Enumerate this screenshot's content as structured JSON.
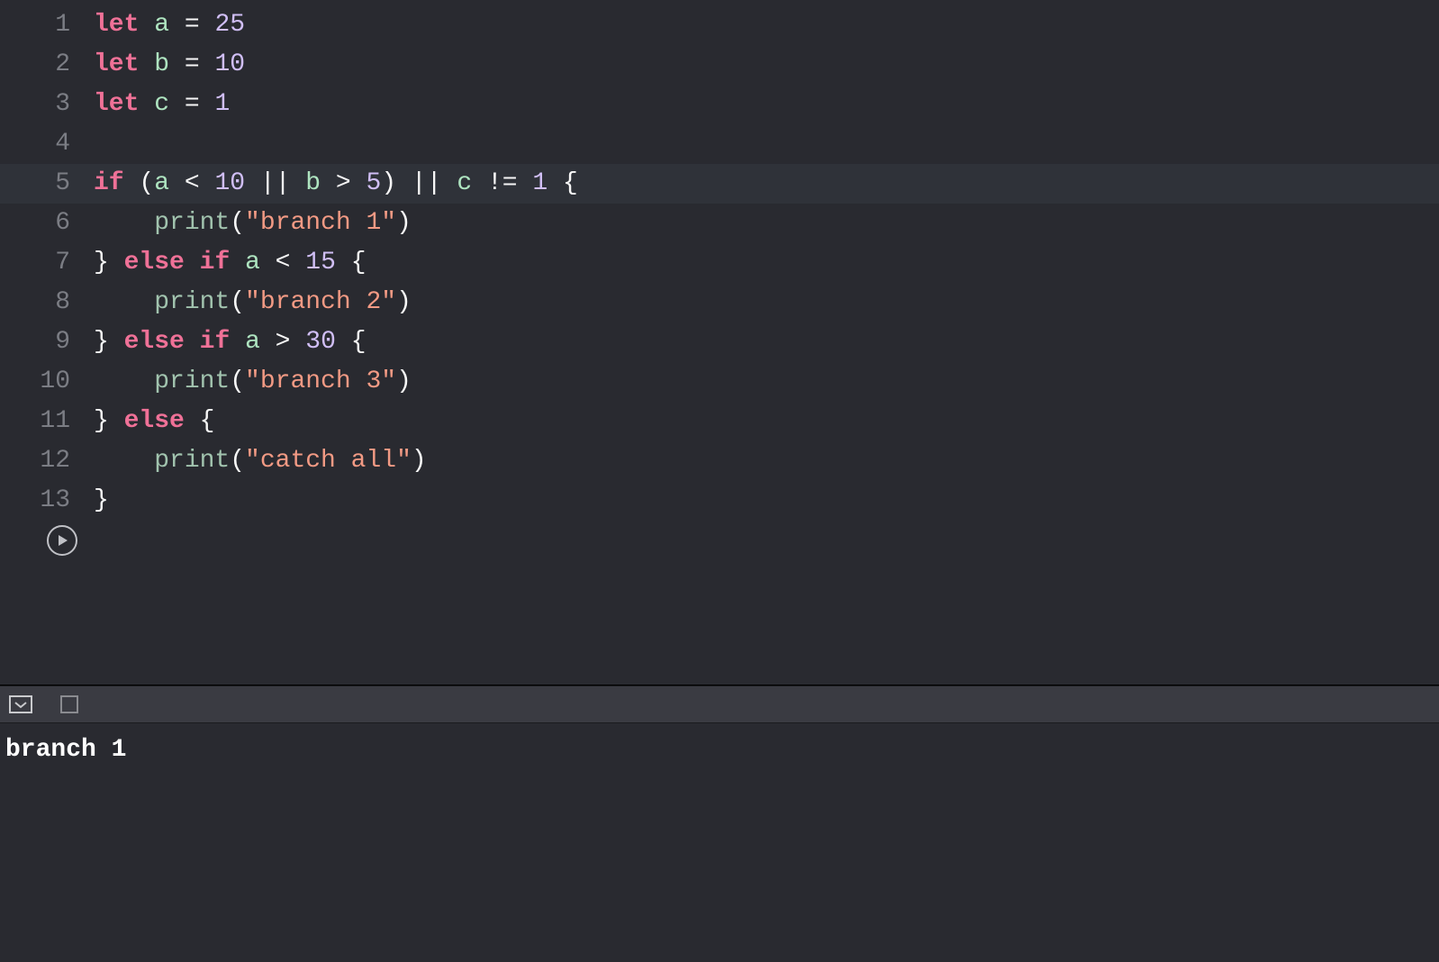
{
  "editor": {
    "highlighted_line": 5,
    "lines": [
      {
        "n": "1",
        "tokens": [
          [
            "kw",
            "let"
          ],
          [
            "pn",
            " "
          ],
          [
            "id",
            "a"
          ],
          [
            "pn",
            " = "
          ],
          [
            "num",
            "25"
          ]
        ]
      },
      {
        "n": "2",
        "tokens": [
          [
            "kw",
            "let"
          ],
          [
            "pn",
            " "
          ],
          [
            "id",
            "b"
          ],
          [
            "pn",
            " = "
          ],
          [
            "num",
            "10"
          ]
        ]
      },
      {
        "n": "3",
        "tokens": [
          [
            "kw",
            "let"
          ],
          [
            "pn",
            " "
          ],
          [
            "id",
            "c"
          ],
          [
            "pn",
            " = "
          ],
          [
            "num",
            "1"
          ]
        ]
      },
      {
        "n": "4",
        "tokens": []
      },
      {
        "n": "5",
        "tokens": [
          [
            "kw",
            "if"
          ],
          [
            "pn",
            " ("
          ],
          [
            "id",
            "a"
          ],
          [
            "pn",
            " < "
          ],
          [
            "num",
            "10"
          ],
          [
            "pn",
            " || "
          ],
          [
            "id",
            "b"
          ],
          [
            "pn",
            " > "
          ],
          [
            "num",
            "5"
          ],
          [
            "pn",
            ") || "
          ],
          [
            "id",
            "c"
          ],
          [
            "pn",
            " != "
          ],
          [
            "num",
            "1"
          ],
          [
            "pn",
            " {"
          ]
        ]
      },
      {
        "n": "6",
        "tokens": [
          [
            "pn",
            "    "
          ],
          [
            "fn",
            "print"
          ],
          [
            "pn",
            "("
          ],
          [
            "str",
            "\"branch 1\""
          ],
          [
            "pn",
            ")"
          ]
        ]
      },
      {
        "n": "7",
        "tokens": [
          [
            "pn",
            "} "
          ],
          [
            "kw",
            "else"
          ],
          [
            "pn",
            " "
          ],
          [
            "kw",
            "if"
          ],
          [
            "pn",
            " "
          ],
          [
            "id",
            "a"
          ],
          [
            "pn",
            " < "
          ],
          [
            "num",
            "15"
          ],
          [
            "pn",
            " {"
          ]
        ]
      },
      {
        "n": "8",
        "tokens": [
          [
            "pn",
            "    "
          ],
          [
            "fn",
            "print"
          ],
          [
            "pn",
            "("
          ],
          [
            "str",
            "\"branch 2\""
          ],
          [
            "pn",
            ")"
          ]
        ]
      },
      {
        "n": "9",
        "tokens": [
          [
            "pn",
            "} "
          ],
          [
            "kw",
            "else"
          ],
          [
            "pn",
            " "
          ],
          [
            "kw",
            "if"
          ],
          [
            "pn",
            " "
          ],
          [
            "id",
            "a"
          ],
          [
            "pn",
            " > "
          ],
          [
            "num",
            "30"
          ],
          [
            "pn",
            " {"
          ]
        ]
      },
      {
        "n": "10",
        "tokens": [
          [
            "pn",
            "    "
          ],
          [
            "fn",
            "print"
          ],
          [
            "pn",
            "("
          ],
          [
            "str",
            "\"branch 3\""
          ],
          [
            "pn",
            ")"
          ]
        ]
      },
      {
        "n": "11",
        "tokens": [
          [
            "pn",
            "} "
          ],
          [
            "kw",
            "else"
          ],
          [
            "pn",
            " {"
          ]
        ]
      },
      {
        "n": "12",
        "tokens": [
          [
            "pn",
            "    "
          ],
          [
            "fn",
            "print"
          ],
          [
            "pn",
            "("
          ],
          [
            "str",
            "\"catch all\""
          ],
          [
            "pn",
            ")"
          ]
        ]
      },
      {
        "n": "13",
        "tokens": [
          [
            "pn",
            "}"
          ]
        ]
      }
    ]
  },
  "console": {
    "output": [
      "branch 1"
    ]
  }
}
